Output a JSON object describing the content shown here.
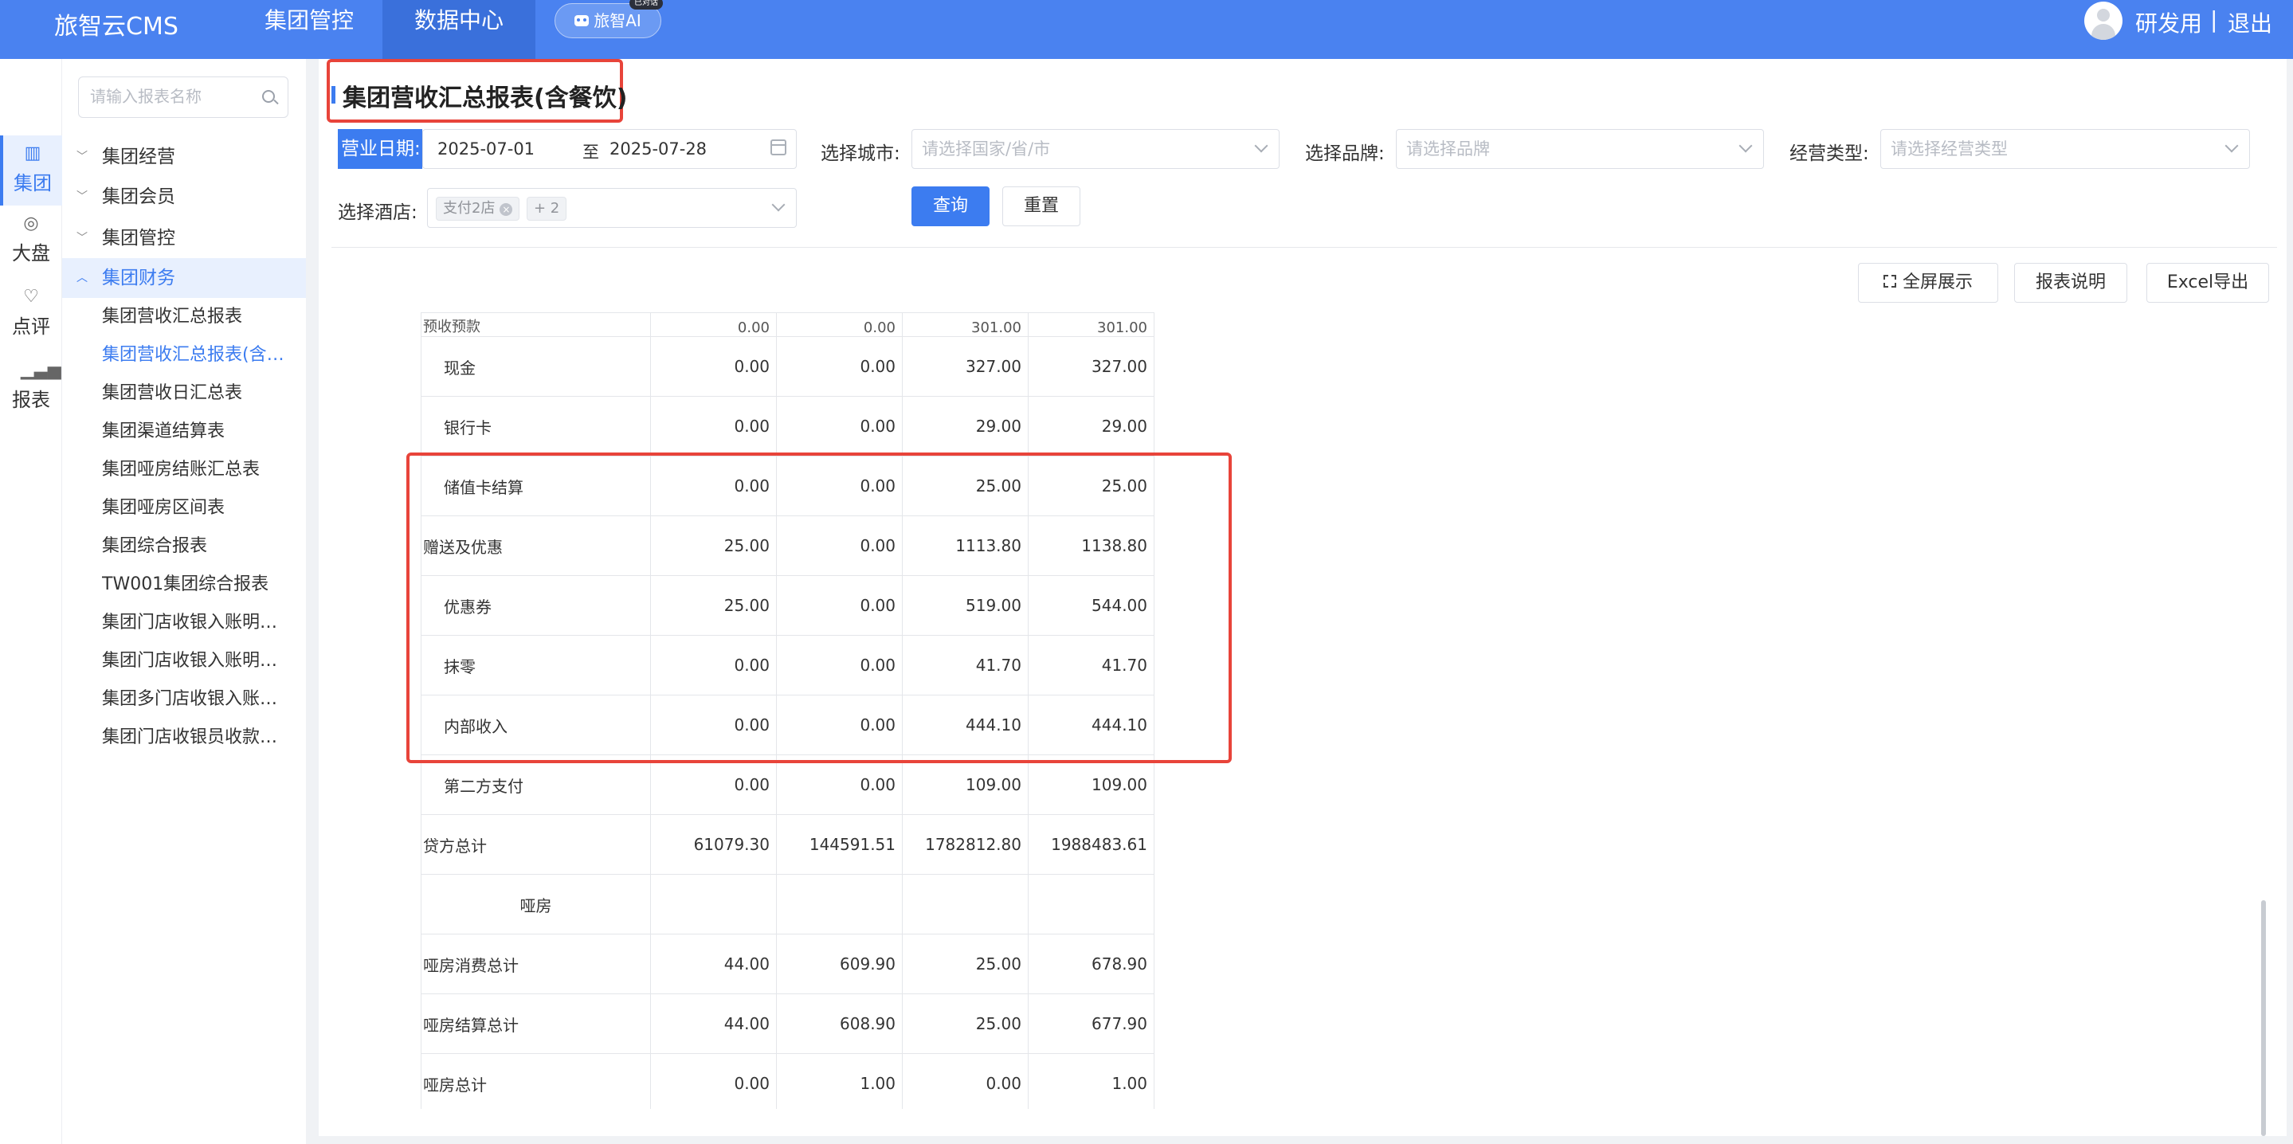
{
  "header": {
    "logo": "旅智云CMS",
    "nav": [
      "集团管控",
      "数据中心"
    ],
    "ai_button": "旅智AI",
    "ai_badge": "已对话",
    "user_name": "研发用",
    "separator": "|",
    "logout": "退出"
  },
  "rail": [
    {
      "label": "集团",
      "icon": "building-icon"
    },
    {
      "label": "大盘",
      "icon": "target-icon"
    },
    {
      "label": "点评",
      "icon": "thumbs-up-icon"
    },
    {
      "label": "报表",
      "icon": "bar-chart-icon"
    }
  ],
  "menu": {
    "search_placeholder": "请输入报表名称",
    "groups": [
      "集团经营",
      "集团会员",
      "集团管控",
      "集团财务"
    ],
    "items": [
      "集团营收汇总报表",
      "集团营收汇总报表(含餐饮)",
      "集团营收日汇总表",
      "集团渠道结算表",
      "集团哑房结账汇总表",
      "集团哑房区间表",
      "集团综合报表",
      "TW001集团综合报表",
      "集团门店收银入账明细表",
      "集团门店收银入账明细表(含餐饮)",
      "集团多门店收银入账明细表",
      "集团门店收银员收款汇总表"
    ]
  },
  "page": {
    "title": "集团营收汇总报表(含餐饮)",
    "filters": {
      "date_label": "营业日期:",
      "date_start": "2025-07-01",
      "date_to": "至",
      "date_end": "2025-07-28",
      "city_label": "选择城市:",
      "city_placeholder": "请选择国家/省/市",
      "brand_label": "选择品牌:",
      "brand_placeholder": "请选择品牌",
      "type_label": "经营类型:",
      "type_placeholder": "请选择经营类型",
      "hotel_label": "选择酒店:",
      "hotel_tag": "支付2店",
      "hotel_more": "+ 2"
    },
    "query_button": "查询",
    "reset_button": "重置",
    "fullscreen_button": "全屏展示",
    "explain_button": "报表说明",
    "export_button": "Excel导出"
  },
  "table": {
    "cut_row": [
      "预收预款",
      "0.00",
      "0.00",
      "301.00",
      "301.00"
    ],
    "rows": [
      {
        "name": "现金",
        "values": [
          "0.00",
          "0.00",
          "327.00",
          "327.00"
        ],
        "style": "indent"
      },
      {
        "name": "银行卡",
        "values": [
          "0.00",
          "0.00",
          "29.00",
          "29.00"
        ],
        "style": "indent"
      },
      {
        "name": "储值卡结算",
        "values": [
          "0.00",
          "0.00",
          "25.00",
          "25.00"
        ],
        "style": "indent"
      },
      {
        "name": "赠送及优惠",
        "values": [
          "25.00",
          "0.00",
          "1113.80",
          "1138.80"
        ],
        "style": ""
      },
      {
        "name": "优惠券",
        "values": [
          "25.00",
          "0.00",
          "519.00",
          "544.00"
        ],
        "style": "indent"
      },
      {
        "name": "抹零",
        "values": [
          "0.00",
          "0.00",
          "41.70",
          "41.70"
        ],
        "style": "indent"
      },
      {
        "name": "内部收入",
        "values": [
          "0.00",
          "0.00",
          "444.10",
          "444.10"
        ],
        "style": "indent"
      },
      {
        "name": "第二方支付",
        "values": [
          "0.00",
          "0.00",
          "109.00",
          "109.00"
        ],
        "style": "indent"
      },
      {
        "name": "贷方总计",
        "values": [
          "61079.30",
          "144591.51",
          "1782812.80",
          "1988483.61"
        ],
        "style": ""
      },
      {
        "name": "哑房",
        "values": [
          "",
          "",
          "",
          ""
        ],
        "style": "center"
      },
      {
        "name": "哑房消费总计",
        "values": [
          "44.00",
          "609.90",
          "25.00",
          "678.90"
        ],
        "style": ""
      },
      {
        "name": "哑房结算总计",
        "values": [
          "44.00",
          "608.90",
          "25.00",
          "677.90"
        ],
        "style": ""
      },
      {
        "name": "哑房总计",
        "values": [
          "0.00",
          "1.00",
          "0.00",
          "1.00"
        ],
        "style": ""
      }
    ]
  },
  "colors": {
    "header_bg": "#4a82f0",
    "accent": "#3c7cf0",
    "highlight_border": "#e8443a"
  }
}
